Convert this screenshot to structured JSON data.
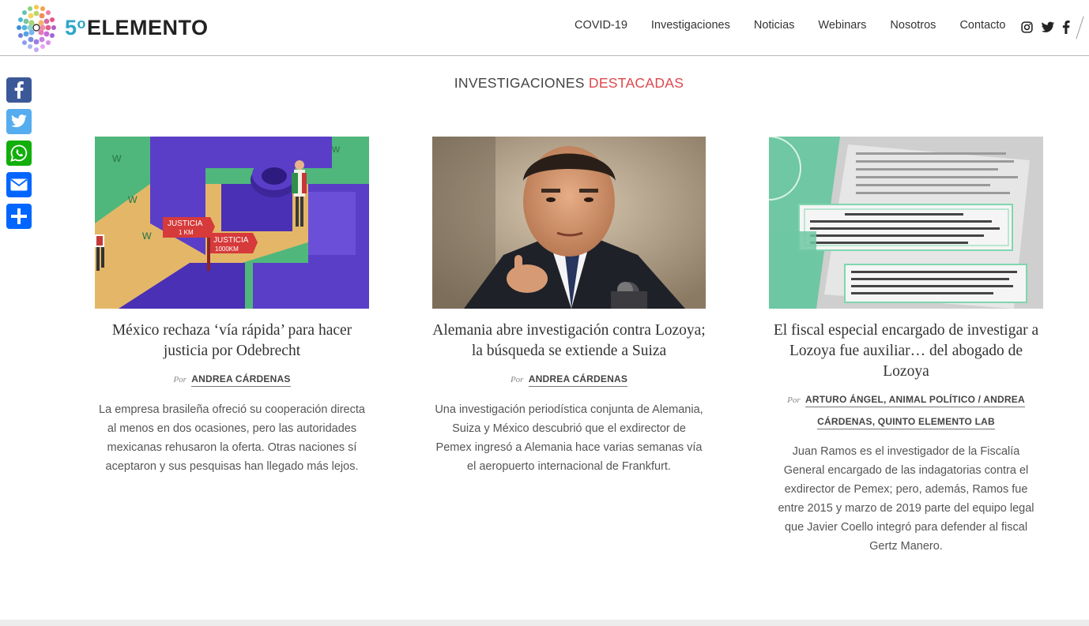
{
  "header": {
    "logo_number": "5",
    "logo_degree": "o",
    "logo_word": "ELEMENTO",
    "nav": [
      "COVID-19",
      "Investigaciones",
      "Noticias",
      "Webinars",
      "Nosotros",
      "Contacto"
    ],
    "social_icons": [
      "instagram-icon",
      "twitter-icon",
      "facebook-icon"
    ]
  },
  "share_bar": {
    "buttons": [
      {
        "icon": "facebook-icon",
        "color": "#3b5998"
      },
      {
        "icon": "twitter-icon",
        "color": "#55acee"
      },
      {
        "icon": "whatsapp-icon",
        "color": "#12af0a"
      },
      {
        "icon": "email-icon",
        "color": "#0166ff"
      },
      {
        "icon": "share-icon",
        "color": "#0166ff"
      }
    ]
  },
  "section": {
    "title_main": "INVESTIGACIONES",
    "title_accent": "DESTACADAS",
    "accent_color": "#e0474c"
  },
  "articles": [
    {
      "title": "México rechaza ‘vía rápida’ para hacer justicia por Odebrecht",
      "by": "Por",
      "author": "ANDREA CÁRDENAS",
      "excerpt": "La empresa brasileña ofreció su cooperación directa al menos en dos ocasiones, pero las autoridades mexicanas rehusaron la oferta. Otras naciones sí aceptaron y sus pesquisas han llegado más lejos.",
      "image": {
        "sign1": "JUSTICIA",
        "sign1b": "1 KM",
        "sign2": "JUSTICIA",
        "sign2b": "1000KM"
      }
    },
    {
      "title": "Alemania abre investigación contra Lozoya; la búsqueda se extiende a Suiza",
      "by": "Por",
      "author": "ANDREA CÁRDENAS",
      "excerpt": "Una investigación periodística conjunta de Alemania, Suiza y México descubrió que el exdirector de Pemex ingresó a Alemania hace varias semanas vía el aeropuerto internacional de Frankfurt."
    },
    {
      "title": "El fiscal especial encargado de investigar a Lozoya fue auxiliar… del abogado de Lozoya",
      "by": "Por",
      "author_line1": "ARTURO ÁNGEL, ANIMAL POLÍTICO / ANDREA",
      "author_line2": "CÁRDENAS, QUINTO ELEMENTO LAB",
      "excerpt": "Juan Ramos es el investigador de la Fiscalía General encargado de las indagatorias contra el exdirector de Pemex; pero, además, Ramos fue entre 2015 y marzo de 2019 parte del equipo legal que Javier Coello integró para defender al fiscal Gertz Manero."
    }
  ]
}
